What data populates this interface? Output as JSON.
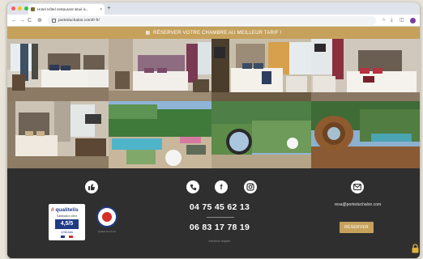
{
  "browser": {
    "tab_title": "Hotel Hôtel restaurant situé à...",
    "tab_close": "×",
    "new_tab": "+",
    "url": "porteduchalon.com/fr-fr/",
    "nav_back": "←",
    "nav_forward": "→",
    "nav_reload": "C",
    "nav_info": "⊕",
    "toolbar_icons": [
      "☆",
      "⤓",
      "◫"
    ]
  },
  "banner": {
    "icon": "calendar-icon",
    "text": "RÉSERVER VOTRE CHAMBRE AU MEILLEUR TARIF !"
  },
  "gallery": {
    "photos": [
      "hotel-room-twin-beds-photo",
      "hotel-room-purple-headboard-photo",
      "hotel-room-double-bed-window-photo",
      "hotel-room-red-pillows-photo",
      "hotel-room-desk-photo",
      "swimming-pool-garden-photo",
      "garden-round-window-photo",
      "barrel-sauna-photo"
    ]
  },
  "footer": {
    "icons": {
      "thumbs_up": "👍",
      "phone": "✆",
      "facebook": "f",
      "instagram": "◎",
      "mail": "✉"
    },
    "qualitelis": {
      "brand_flag": "//",
      "brand": "qualitelis",
      "subtitle": "Satisfaction client",
      "score": "4,5/5",
      "reviews": "1236 Avis"
    },
    "seal_label": "Qualité Tourisme",
    "phone_1": "04 75 45 62 13",
    "phone_2": "06 83 17 78 19",
    "legal": "Mentions légales",
    "email": "resa@porteduchalon.com",
    "reserve_button": "RÉSERVER"
  },
  "colors": {
    "accent": "#c6a15b",
    "footer_bg": "#2f2f2f"
  }
}
